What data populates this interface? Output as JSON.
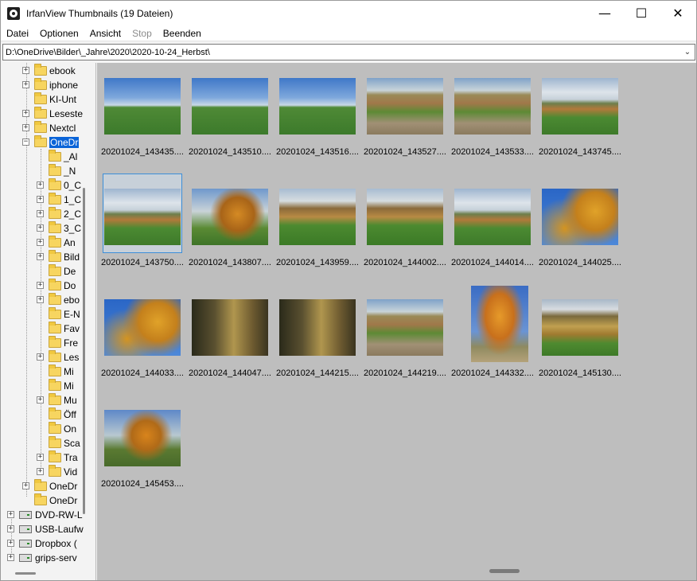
{
  "window": {
    "title": "IrfanView Thumbnails (19 Dateien)",
    "minimize_glyph": "—",
    "maximize_glyph": "☐",
    "close_glyph": "✕"
  },
  "menu": [
    {
      "label": "Datei",
      "disabled": false
    },
    {
      "label": "Optionen",
      "disabled": false
    },
    {
      "label": "Ansicht",
      "disabled": false
    },
    {
      "label": "Stop",
      "disabled": true
    },
    {
      "label": "Beenden",
      "disabled": false
    }
  ],
  "path": {
    "value": "D:\\OneDrive\\Bilder\\_Jahre\\2020\\2020-10-24_Herbst\\",
    "dropdown_glyph": "⌄"
  },
  "tree": {
    "top_items": [
      {
        "label": "ebook",
        "expandable": true
      },
      {
        "label": "iphone",
        "expandable": true
      },
      {
        "label": "KI-Unt",
        "expandable": false
      },
      {
        "label": "Leseste",
        "expandable": true
      },
      {
        "label": "Nextcl",
        "expandable": true
      },
      {
        "label": "OneDr",
        "expandable": true,
        "selected": true
      }
    ],
    "children": [
      {
        "label": "_Al",
        "expandable": false
      },
      {
        "label": "_N",
        "expandable": false
      },
      {
        "label": "0_C",
        "expandable": true
      },
      {
        "label": "1_C",
        "expandable": true
      },
      {
        "label": "2_C",
        "expandable": true
      },
      {
        "label": "3_C",
        "expandable": true
      },
      {
        "label": "An",
        "expandable": true
      },
      {
        "label": "Bild",
        "expandable": true
      },
      {
        "label": "De",
        "expandable": false
      },
      {
        "label": "Do",
        "expandable": true
      },
      {
        "label": "ebo",
        "expandable": true
      },
      {
        "label": "E-N",
        "expandable": false
      },
      {
        "label": "Fav",
        "expandable": false
      },
      {
        "label": "Fre",
        "expandable": false
      },
      {
        "label": "Les",
        "expandable": true
      },
      {
        "label": "Mi",
        "expandable": false
      },
      {
        "label": "Mi",
        "expandable": false
      },
      {
        "label": "Mu",
        "expandable": true
      },
      {
        "label": "Öff",
        "expandable": false
      },
      {
        "label": "On",
        "expandable": false
      },
      {
        "label": "Sca",
        "expandable": false
      },
      {
        "label": "Tra",
        "expandable": true
      },
      {
        "label": "Vid",
        "expandable": true
      }
    ],
    "after_items": [
      {
        "label": "OneDr",
        "expandable": true
      },
      {
        "label": "OneDr",
        "expandable": false
      }
    ],
    "drives": [
      {
        "label": "DVD-RW-L"
      },
      {
        "label": "USB-Laufw"
      },
      {
        "label": "Dropbox ("
      },
      {
        "label": "grips-serv"
      }
    ]
  },
  "thumbnails": [
    {
      "label": "20201024_143435....",
      "style": "sky-day",
      "orient": "landscape"
    },
    {
      "label": "20201024_143510....",
      "style": "sky-day",
      "orient": "landscape"
    },
    {
      "label": "20201024_143516....",
      "style": "sky-day",
      "orient": "landscape"
    },
    {
      "label": "20201024_143527....",
      "style": "path-walk",
      "orient": "landscape"
    },
    {
      "label": "20201024_143533....",
      "style": "path-walk",
      "orient": "landscape"
    },
    {
      "label": "20201024_143745....",
      "style": "sky-cloud",
      "orient": "landscape"
    },
    {
      "label": "20201024_143750....",
      "style": "sky-cloud",
      "orient": "landscape",
      "selected": true
    },
    {
      "label": "20201024_143807....",
      "style": "meadow-tree",
      "orient": "landscape"
    },
    {
      "label": "20201024_143959....",
      "style": "forest",
      "orient": "landscape"
    },
    {
      "label": "20201024_144002....",
      "style": "forest",
      "orient": "landscape"
    },
    {
      "label": "20201024_144014....",
      "style": "sky-cloud",
      "orient": "landscape"
    },
    {
      "label": "20201024_144025....",
      "style": "leaves",
      "orient": "landscape"
    },
    {
      "label": "20201024_144033....",
      "style": "leaves",
      "orient": "landscape"
    },
    {
      "label": "20201024_144047....",
      "style": "lane",
      "orient": "landscape"
    },
    {
      "label": "20201024_144215....",
      "style": "lane",
      "orient": "landscape"
    },
    {
      "label": "20201024_144219....",
      "style": "path-walk",
      "orient": "landscape"
    },
    {
      "label": "20201024_144332....",
      "style": "tall-tree",
      "orient": "portrait"
    },
    {
      "label": "20201024_145130....",
      "style": "castle",
      "orient": "landscape"
    },
    {
      "label": "20201024_145453....",
      "style": "tree-sunset",
      "orient": "landscape"
    }
  ]
}
